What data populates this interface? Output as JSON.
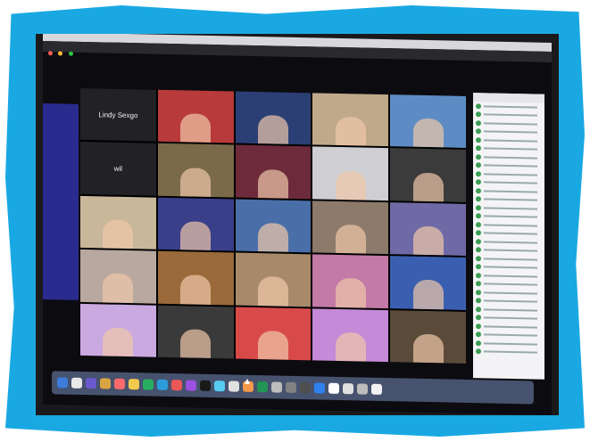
{
  "gallery": {
    "tiles": [
      {
        "type": "name",
        "label": "Lindy Sexgo"
      },
      {
        "type": "video",
        "color": "#b83a3a"
      },
      {
        "type": "video",
        "color": "#2b3f74"
      },
      {
        "type": "video",
        "color": "#c0a98a"
      },
      {
        "type": "video",
        "color": "#5d8cc4"
      },
      {
        "type": "name",
        "label": "wil"
      },
      {
        "type": "video",
        "color": "#7a6a4a"
      },
      {
        "type": "video",
        "color": "#6c2a3a"
      },
      {
        "type": "video",
        "color": "#cfcfd3"
      },
      {
        "type": "video",
        "color": "#3b3b3b"
      },
      {
        "type": "video",
        "color": "#c9b79a"
      },
      {
        "type": "video",
        "color": "#3a3f8a"
      },
      {
        "type": "video",
        "color": "#4a6fa8"
      },
      {
        "type": "video",
        "color": "#8c7a6a"
      },
      {
        "type": "video",
        "color": "#6f6aa6"
      },
      {
        "type": "video",
        "color": "#b8a8a0"
      },
      {
        "type": "video",
        "color": "#9a6a3a"
      },
      {
        "type": "video",
        "color": "#a88a6a"
      },
      {
        "type": "video",
        "color": "#c37aa6"
      },
      {
        "type": "video",
        "color": "#3b5fb0"
      },
      {
        "type": "video",
        "color": "#c9a9e0"
      },
      {
        "type": "video",
        "color": "#3a3a3a"
      },
      {
        "type": "video",
        "color": "#d84a4a"
      },
      {
        "type": "video",
        "color": "#c58ad8"
      },
      {
        "type": "video",
        "color": "#5a4a3a"
      }
    ]
  },
  "colors": {
    "frame": "#1aa8e3",
    "slide": "#2a2b8f",
    "participant_status": "#3b9c52"
  },
  "participants": {
    "count_rows": 30
  }
}
